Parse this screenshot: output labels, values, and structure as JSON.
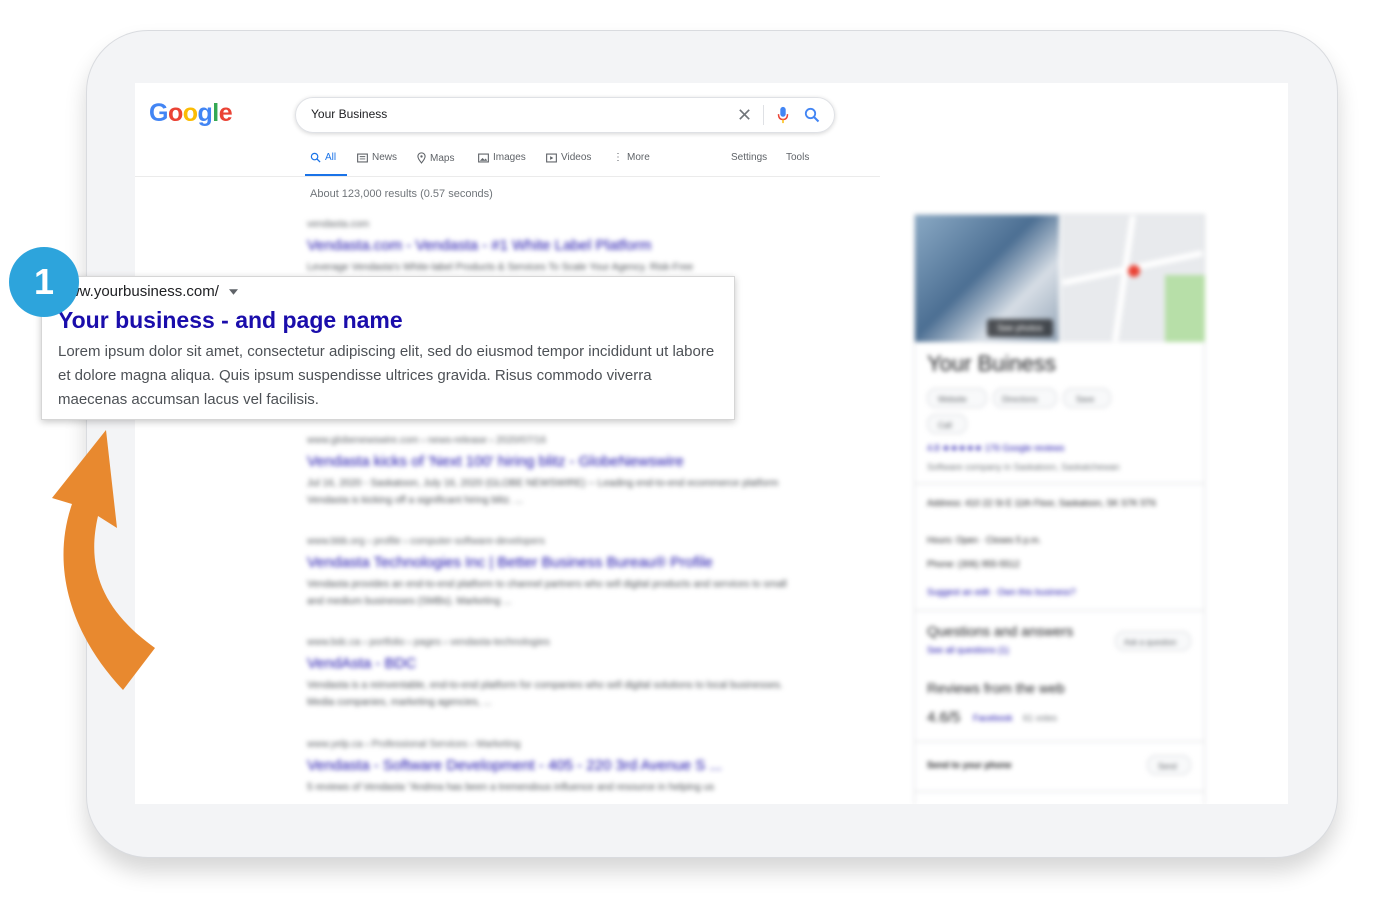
{
  "search": {
    "logo_letters": [
      {
        "ch": "G",
        "color": "#4285f4"
      },
      {
        "ch": "o",
        "color": "#ea4335"
      },
      {
        "ch": "o",
        "color": "#fbbc05"
      },
      {
        "ch": "g",
        "color": "#4285f4"
      },
      {
        "ch": "l",
        "color": "#34a853"
      },
      {
        "ch": "e",
        "color": "#ea4335"
      }
    ],
    "query": "Your Business",
    "stats": "About 123,000 results (0.57 seconds)"
  },
  "tabs": {
    "all": "All",
    "news": "News",
    "maps": "Maps",
    "images": "Images",
    "videos": "Videos",
    "more": "More",
    "settings": "Settings",
    "tools": "Tools"
  },
  "featured_result": {
    "step_number": "1",
    "url": "www.yourbusiness.com/",
    "title": "Your business - and page name",
    "description": "Lorem ipsum dolor sit amet, consectetur adipiscing elit, sed do eiusmod tempor incididunt ut labore et dolore magna aliqua. Quis ipsum suspendisse ultrices gravida. Risus commodo viverra maecenas accumsan lacus vel facilisis."
  },
  "blurred_results": [
    {
      "cite": "vendasta.com",
      "title": "Vendasta.com - Vendasta - #1 White Label Platform",
      "snippet": "Leverage Vendasta's White-label Products & Services To Scale Your Agency. Risk-Free"
    },
    {
      "cite": "www.globenewswire.com › news-release › 2020/07/16",
      "title": "Vendasta kicks of 'Next 100' hiring blitz - GlobeNewswire",
      "snippet": "Jul 16, 2020 - Saskatoon, July 16, 2020 (GLOBE NEWSWIRE) -- Leading end-to-end ecommerce platform Vendasta is kicking off a significant hiring blitz. ..."
    },
    {
      "cite": "www.bbb.org › profile › computer-software-developers",
      "title": "Vendasta Technologies Inc | Better Business Bureau® Profile",
      "snippet": "Vendasta provides an end-to-end platform to channel partners who sell digital products and services to small and medium businesses (SMBs). Marketing ..."
    },
    {
      "cite": "www.bdc.ca › portfolio › pages › vendasta-technologies",
      "title": "VendAsta - BDC",
      "snippet": "Vendasta is a reinventable, end-to-end platform for companies who sell digital solutions to local businesses. Media companies, marketing agencies, ..."
    },
    {
      "cite": "www.yelp.ca › Professional Services › Marketing",
      "title": "Vendasta - Software Development - 405 - 220 3rd Avenue S ...",
      "snippet": "5 reviews of Vendasta \"Andrea has been a tremendous influence and resource in helping us"
    }
  ],
  "knowledge_panel": {
    "name": "Your Buiness",
    "see_photos": "See photos",
    "buttons": [
      "Website",
      "Directions",
      "Save",
      "Call"
    ],
    "rating_line": "4.8 ★★★★★ 176 Google reviews",
    "category": "Software company in Saskatoon, Saskatchewan",
    "address": "Address: 410 22 St E 11th Floor, Saskatoon, SK S7K 5T6",
    "hours": "Hours: Open · Closes 5 p.m.",
    "phone": "Phone: (306) 955-5512",
    "suggest": "Suggest an edit · Own this business?",
    "qa_title": "Questions and answers",
    "qa_link": "See all questions (1)",
    "qa_button": "Ask a question",
    "reviews_title": "Reviews from the web",
    "reviews_score": "4.6/5",
    "reviews_source": "Facebook",
    "reviews_votes": "61 votes",
    "send_label": "Send to your phone",
    "send_button": "Send"
  },
  "colors": {
    "accent_blue": "#1a73e8",
    "link_title": "#1a0dab",
    "badge": "#2da4dc",
    "arrow": "#e8892f",
    "stars": "#fbbc05"
  }
}
